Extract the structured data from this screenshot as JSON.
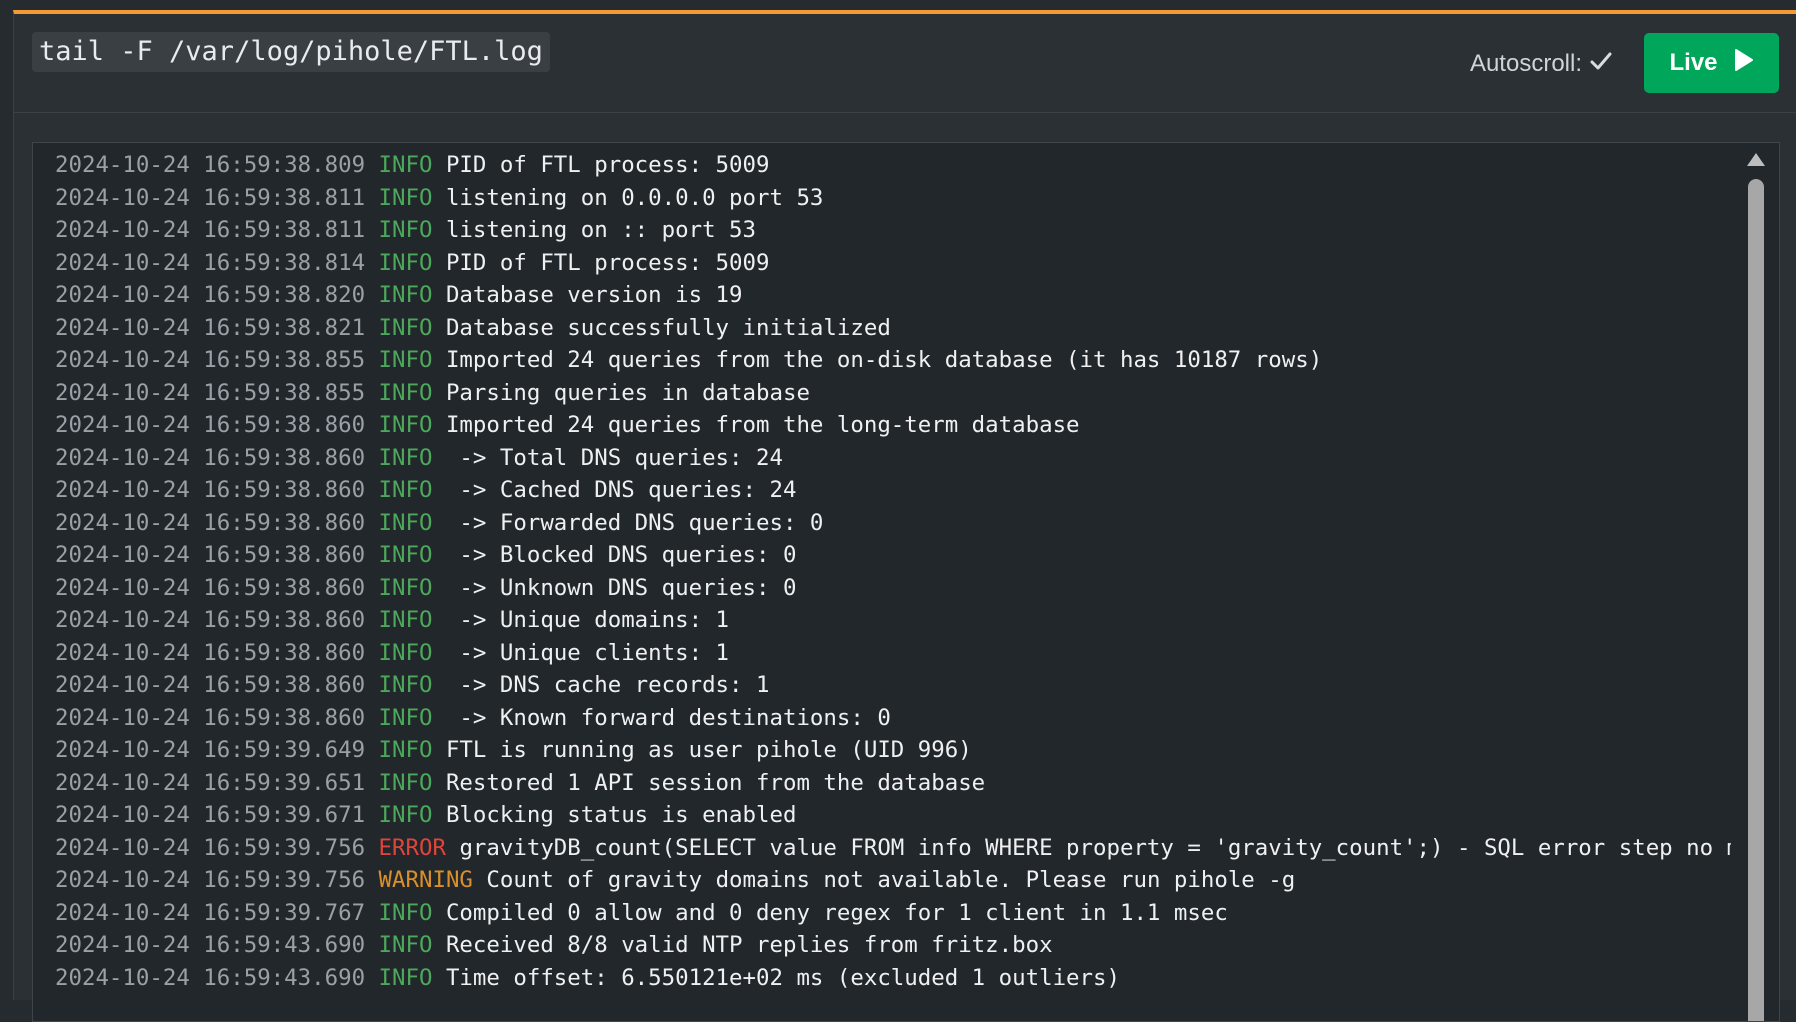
{
  "header": {
    "command": "tail -F /var/log/pihole/FTL.log",
    "autoscroll_label": "Autoscroll:",
    "live_label": "Live"
  },
  "icons": {
    "autoscroll": "check-icon",
    "live": "play-icon",
    "scroll_up": "chevron-up-icon"
  },
  "colors": {
    "accent": "#f39a32",
    "live_button": "#00a65a",
    "info": "#4ca85a",
    "error": "#e0443a",
    "warning": "#d9902b"
  },
  "log_lines": [
    {
      "ts": "2024-10-24 16:59:38.809",
      "level": "INFO",
      "msg": "PID of FTL process: 5009"
    },
    {
      "ts": "2024-10-24 16:59:38.811",
      "level": "INFO",
      "msg": "listening on 0.0.0.0 port 53"
    },
    {
      "ts": "2024-10-24 16:59:38.811",
      "level": "INFO",
      "msg": "listening on :: port 53"
    },
    {
      "ts": "2024-10-24 16:59:38.814",
      "level": "INFO",
      "msg": "PID of FTL process: 5009"
    },
    {
      "ts": "2024-10-24 16:59:38.820",
      "level": "INFO",
      "msg": "Database version is 19"
    },
    {
      "ts": "2024-10-24 16:59:38.821",
      "level": "INFO",
      "msg": "Database successfully initialized"
    },
    {
      "ts": "2024-10-24 16:59:38.855",
      "level": "INFO",
      "msg": "Imported 24 queries from the on-disk database (it has 10187 rows)"
    },
    {
      "ts": "2024-10-24 16:59:38.855",
      "level": "INFO",
      "msg": "Parsing queries in database"
    },
    {
      "ts": "2024-10-24 16:59:38.860",
      "level": "INFO",
      "msg": "Imported 24 queries from the long-term database"
    },
    {
      "ts": "2024-10-24 16:59:38.860",
      "level": "INFO",
      "msg": " -> Total DNS queries: 24"
    },
    {
      "ts": "2024-10-24 16:59:38.860",
      "level": "INFO",
      "msg": " -> Cached DNS queries: 24"
    },
    {
      "ts": "2024-10-24 16:59:38.860",
      "level": "INFO",
      "msg": " -> Forwarded DNS queries: 0"
    },
    {
      "ts": "2024-10-24 16:59:38.860",
      "level": "INFO",
      "msg": " -> Blocked DNS queries: 0"
    },
    {
      "ts": "2024-10-24 16:59:38.860",
      "level": "INFO",
      "msg": " -> Unknown DNS queries: 0"
    },
    {
      "ts": "2024-10-24 16:59:38.860",
      "level": "INFO",
      "msg": " -> Unique domains: 1"
    },
    {
      "ts": "2024-10-24 16:59:38.860",
      "level": "INFO",
      "msg": " -> Unique clients: 1"
    },
    {
      "ts": "2024-10-24 16:59:38.860",
      "level": "INFO",
      "msg": " -> DNS cache records: 1"
    },
    {
      "ts": "2024-10-24 16:59:38.860",
      "level": "INFO",
      "msg": " -> Known forward destinations: 0"
    },
    {
      "ts": "2024-10-24 16:59:39.649",
      "level": "INFO",
      "msg": "FTL is running as user pihole (UID 996)"
    },
    {
      "ts": "2024-10-24 16:59:39.651",
      "level": "INFO",
      "msg": "Restored 1 API session from the database"
    },
    {
      "ts": "2024-10-24 16:59:39.671",
      "level": "INFO",
      "msg": "Blocking status is enabled"
    },
    {
      "ts": "2024-10-24 16:59:39.756",
      "level": "ERROR",
      "msg": "gravityDB_count(SELECT value FROM info WHERE property = 'gravity_count';) - SQL error step no more rows av"
    },
    {
      "ts": "2024-10-24 16:59:39.756",
      "level": "WARNING",
      "msg": "Count of gravity domains not available. Please run pihole -g"
    },
    {
      "ts": "2024-10-24 16:59:39.767",
      "level": "INFO",
      "msg": "Compiled 0 allow and 0 deny regex for 1 client in 1.1 msec"
    },
    {
      "ts": "2024-10-24 16:59:43.690",
      "level": "INFO",
      "msg": "Received 8/8 valid NTP replies from fritz.box"
    },
    {
      "ts": "2024-10-24 16:59:43.690",
      "level": "INFO",
      "msg": "Time offset: 6.550121e+02 ms (excluded 1 outliers)"
    }
  ]
}
